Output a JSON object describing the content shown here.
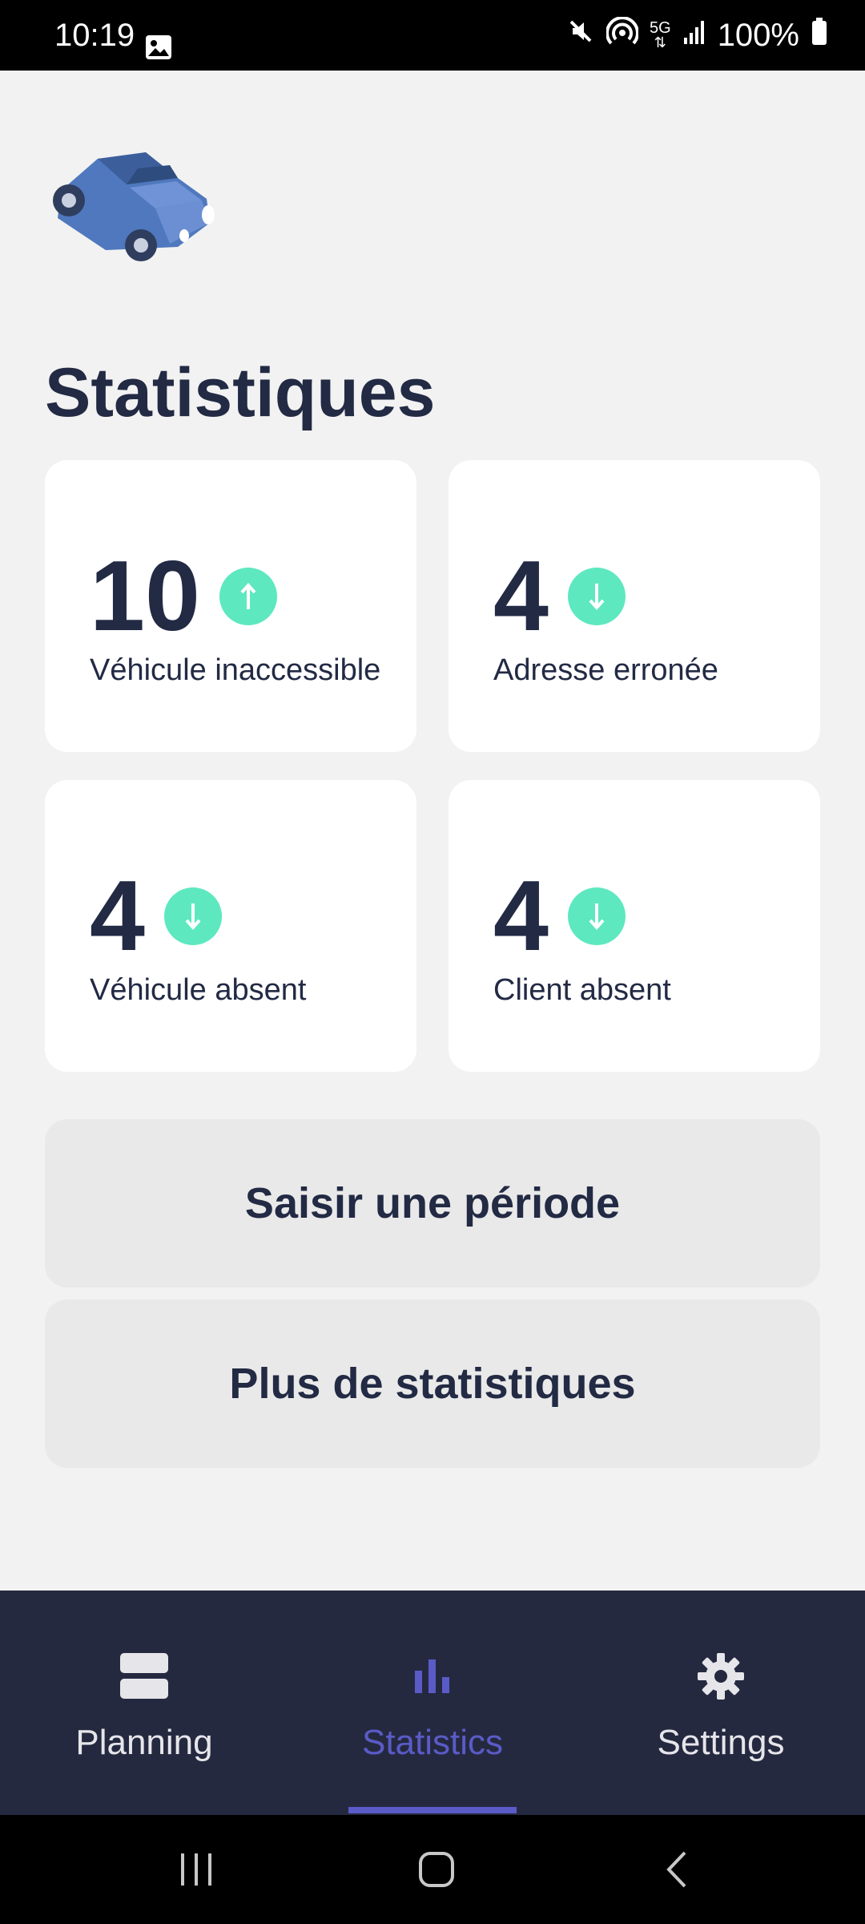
{
  "status_bar": {
    "time": "10:19",
    "battery": "100%",
    "network": "5G",
    "icons": [
      "gallery-icon",
      "mute-icon",
      "hotspot-icon",
      "network-5g-icon",
      "signal-icon",
      "battery-icon"
    ]
  },
  "page": {
    "title": "Statistiques"
  },
  "stats": [
    {
      "value": "10",
      "label": "Véhicule inaccessible",
      "trend": "up"
    },
    {
      "value": "4",
      "label": "Adresse erronée",
      "trend": "down"
    },
    {
      "value": "4",
      "label": "Véhicule absent",
      "trend": "down"
    },
    {
      "value": "4",
      "label": "Client absent",
      "trend": "down"
    }
  ],
  "actions": {
    "period_label": "Saisir une période",
    "more_label": "Plus de statistiques"
  },
  "nav": {
    "items": [
      {
        "label": "Planning",
        "icon": "planning-icon"
      },
      {
        "label": "Statistics",
        "icon": "bar-chart-icon",
        "active": true
      },
      {
        "label": "Settings",
        "icon": "gear-icon"
      }
    ]
  },
  "colors": {
    "text_primary": "#222a44",
    "trend_badge": "#5de8c0",
    "nav_background": "#252940",
    "nav_active": "#5a5bc7",
    "background": "#f2f2f2"
  }
}
